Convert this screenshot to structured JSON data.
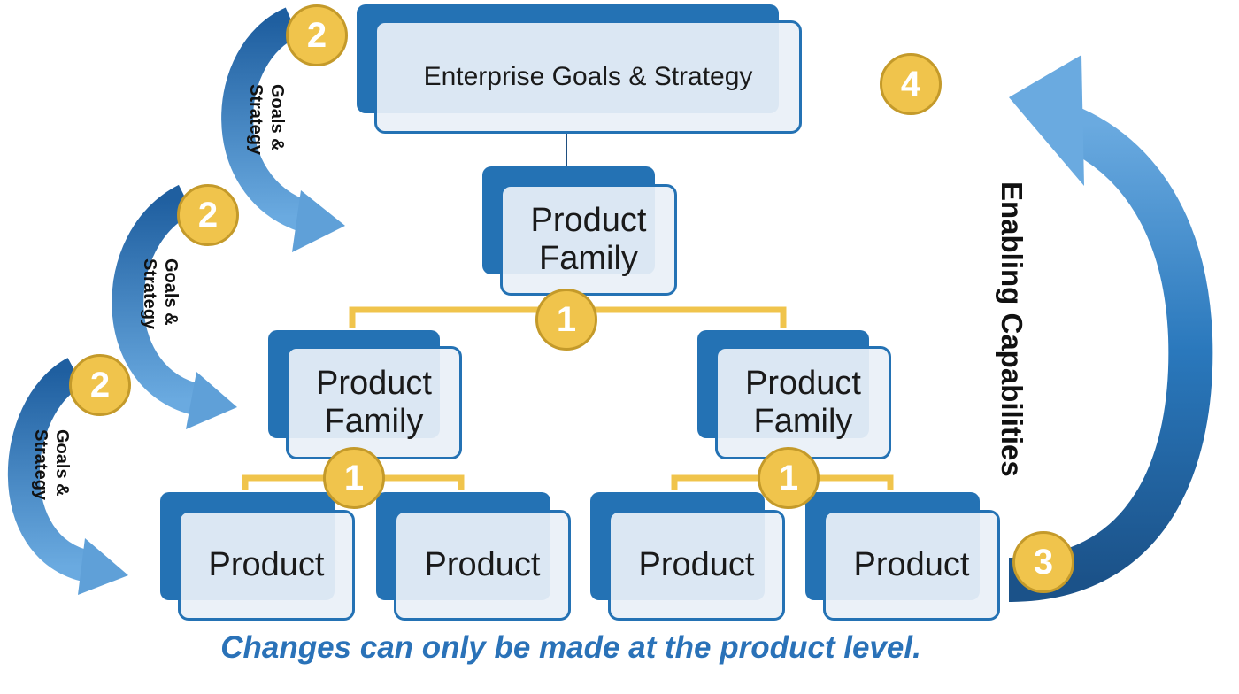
{
  "nodes": {
    "enterprise": "Enterprise Goals & Strategy",
    "family_top": "Product Family",
    "family_left": "Product Family",
    "family_right": "Product Family",
    "products": [
      "Product",
      "Product",
      "Product",
      "Product"
    ]
  },
  "badges": {
    "one": "1",
    "two": "2",
    "three": "3",
    "four": "4"
  },
  "arrows": {
    "goals_line1": "Goals &",
    "goals_line2": "Strategy",
    "enabling": "Enabling Capabilities"
  },
  "caption": "Changes can only be made at the product level.",
  "colors": {
    "box_dark": "#2472b4",
    "box_light": "#eaf0f7",
    "badge": "#f0c44c",
    "connector": "#f0c44c",
    "caption": "#2a72b8"
  }
}
